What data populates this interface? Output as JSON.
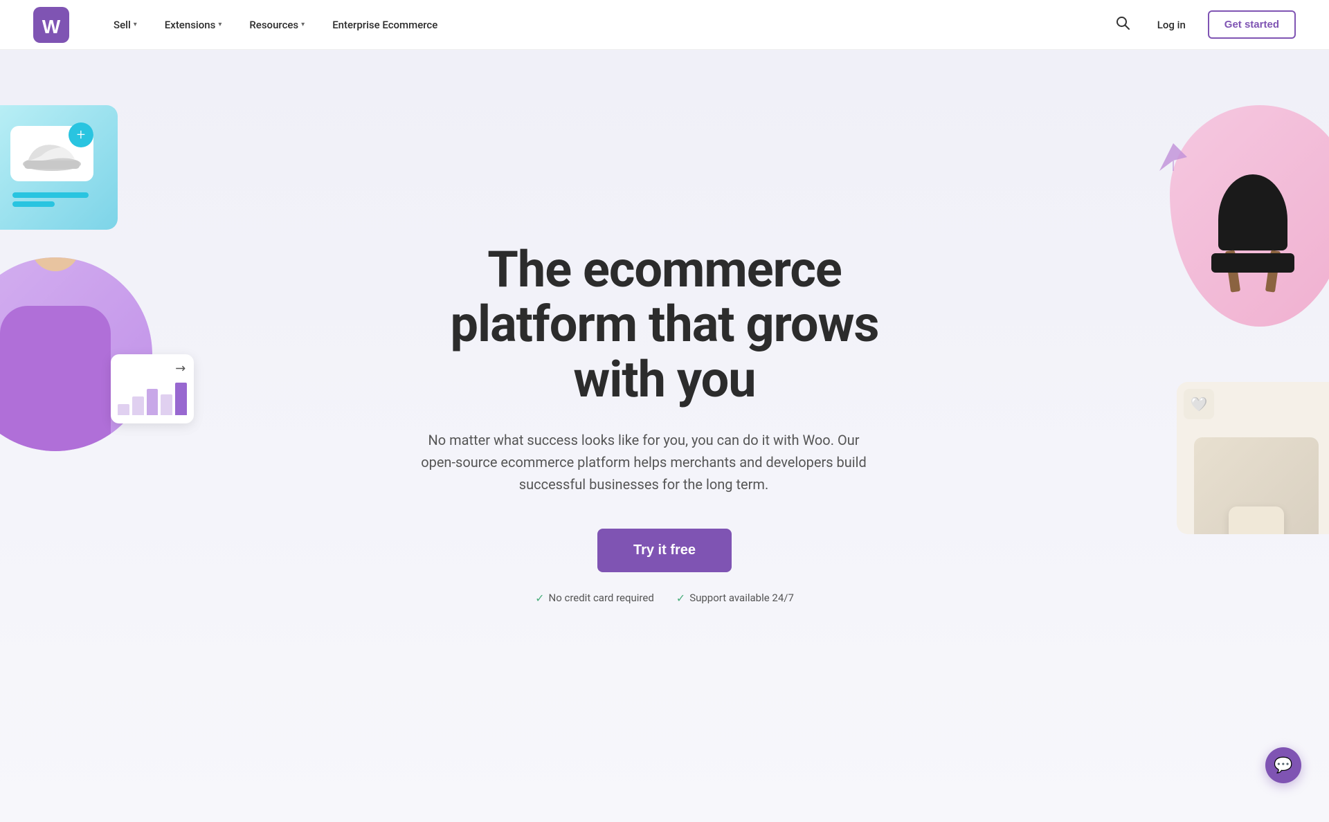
{
  "nav": {
    "logo_text": "Woo",
    "links": [
      {
        "label": "Sell",
        "has_dropdown": true
      },
      {
        "label": "Extensions",
        "has_dropdown": true
      },
      {
        "label": "Resources",
        "has_dropdown": true
      },
      {
        "label": "Enterprise Ecommerce",
        "has_dropdown": false
      }
    ],
    "login_label": "Log in",
    "get_started_label": "Get started"
  },
  "hero": {
    "title": "The ecommerce platform that grows with you",
    "subtitle": "No matter what success looks like for you, you can do it with Woo. Our open-source ecommerce platform helps merchants and developers build successful businesses for the long term.",
    "cta_label": "Try it free",
    "trust_items": [
      {
        "label": "No credit card required"
      },
      {
        "label": "Support available 24/7"
      }
    ]
  },
  "colors": {
    "brand_purple": "#7f54b3",
    "brand_teal": "#29c4e0",
    "check_green": "#4caf7d",
    "pink_bg": "#f5c8e0"
  },
  "chat": {
    "icon": "💬"
  }
}
